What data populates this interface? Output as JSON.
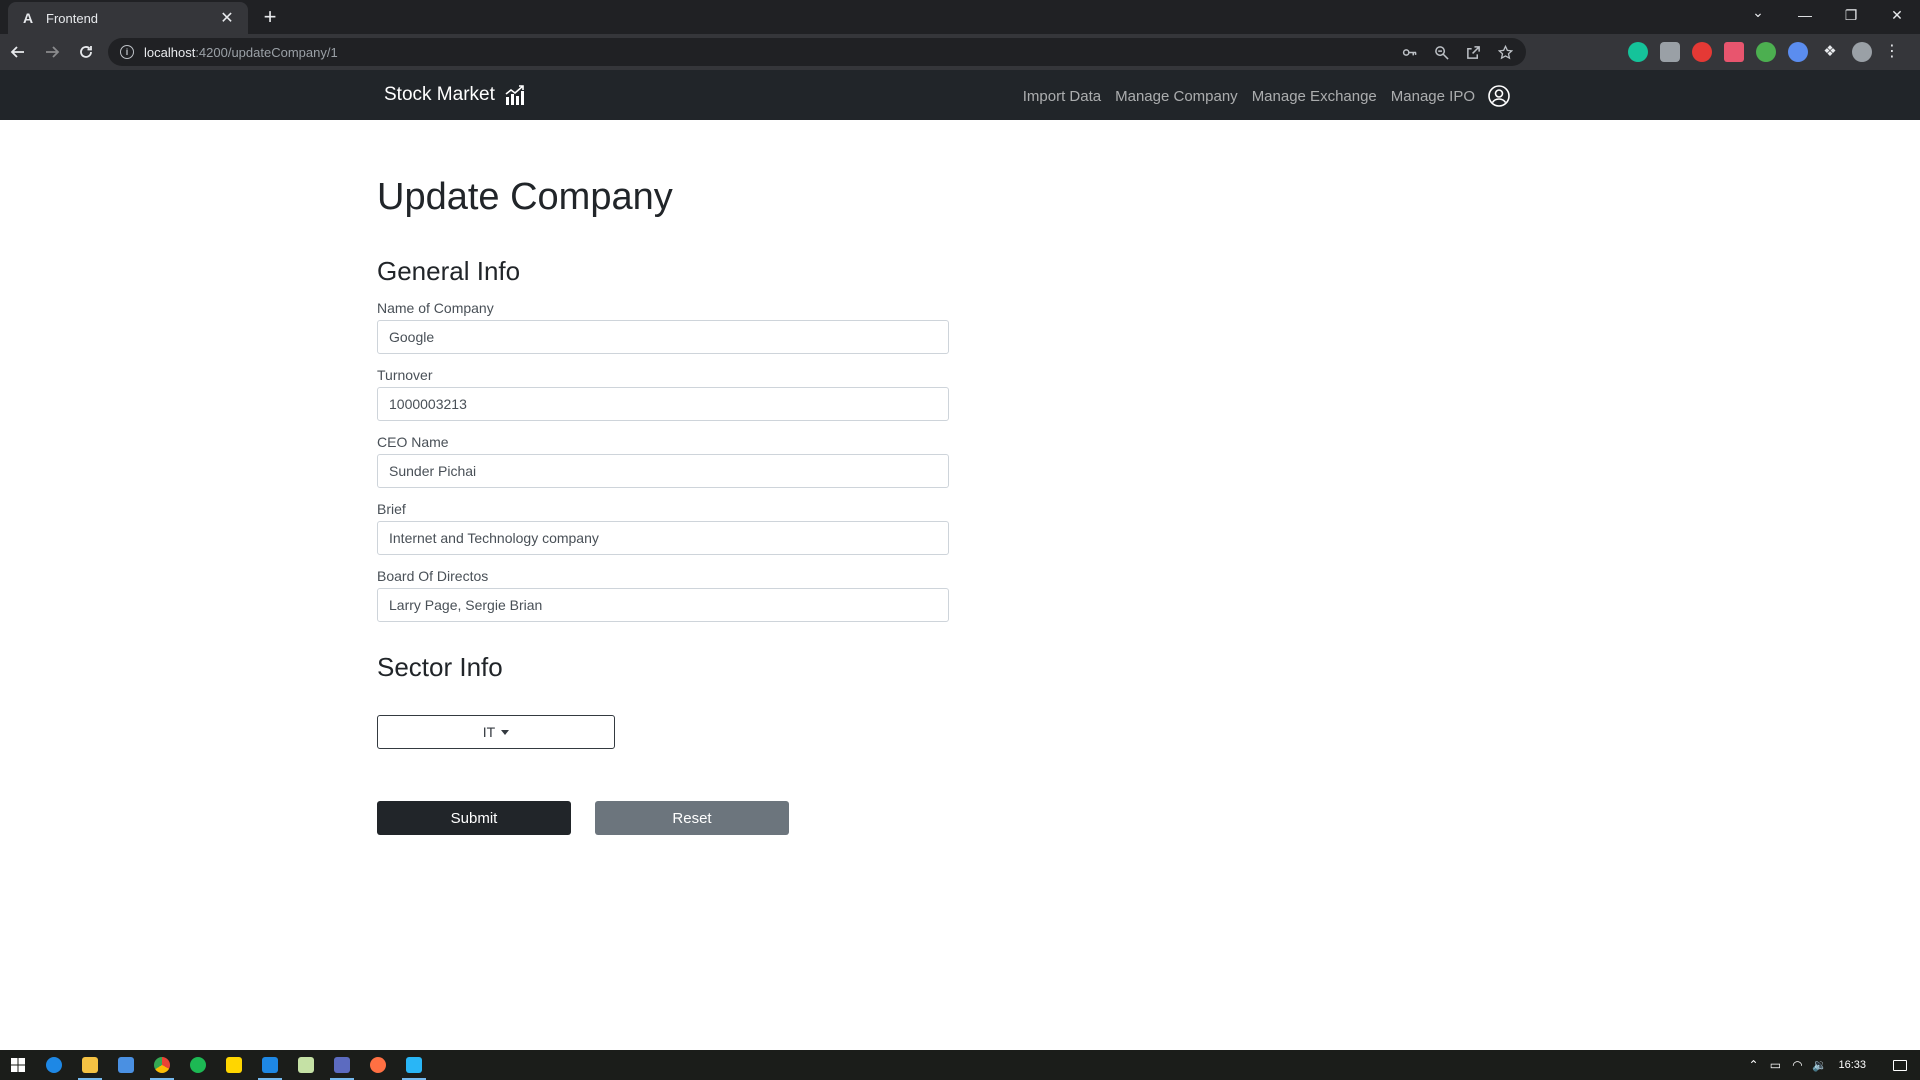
{
  "browser": {
    "tab_title": "Frontend",
    "tab_favicon": "A",
    "url_host": "localhost",
    "url_path": ":4200/updateCompany/1"
  },
  "navbar": {
    "brand": "Stock Market",
    "links": [
      "Import Data",
      "Manage Company",
      "Manage Exchange",
      "Manage IPO"
    ]
  },
  "form": {
    "title": "Update Company",
    "general_heading": "General Info",
    "fields": [
      {
        "label": "Name of Company",
        "value": "Google"
      },
      {
        "label": "Turnover",
        "value": "1000003213"
      },
      {
        "label": "CEO Name",
        "value": "Sunder Pichai"
      },
      {
        "label": "Brief",
        "value": "Internet and Technology company"
      },
      {
        "label": "Board Of Directos",
        "value": "Larry Page, Sergie Brian"
      }
    ],
    "sector_heading": "Sector Info",
    "sector_value": "IT",
    "submit_label": "Submit",
    "reset_label": "Reset"
  },
  "taskbar": {
    "time": "16:33",
    "apps": [
      "windows-start",
      "edge",
      "file-explorer",
      "store",
      "chrome",
      "spotify",
      "sticky-notes",
      "vscode",
      "notepad",
      "app",
      "app",
      "app"
    ]
  },
  "colors": {
    "navbar_bg": "#212529",
    "submit_bg": "#212529",
    "reset_bg": "#6c757d",
    "chrome_bg": "#202124"
  }
}
